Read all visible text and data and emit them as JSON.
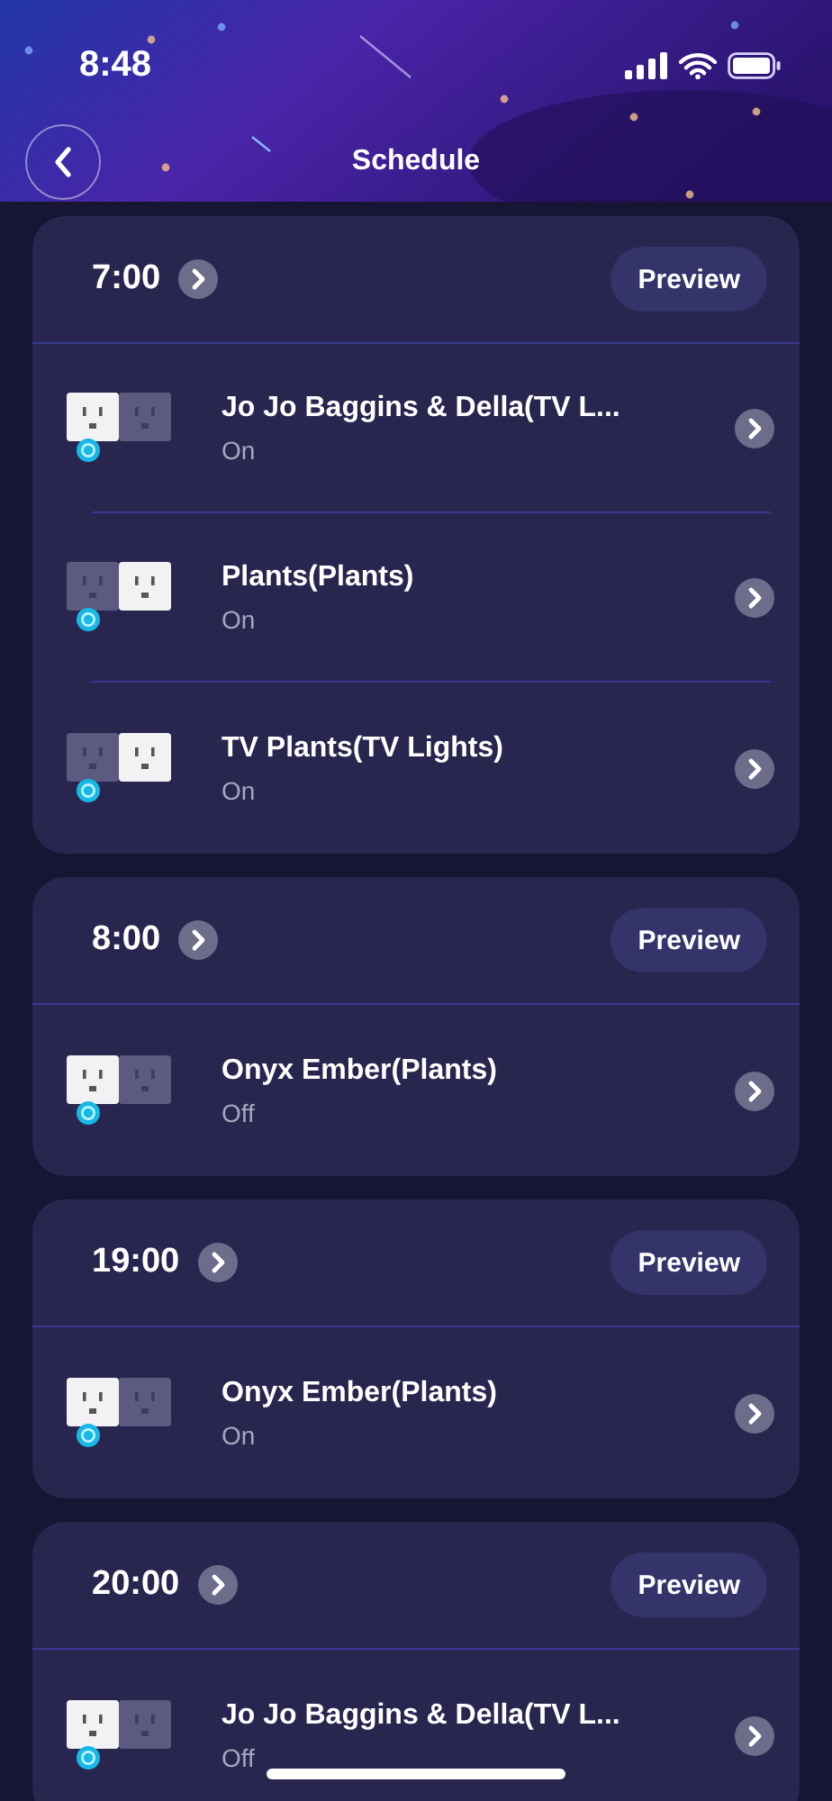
{
  "status_bar": {
    "time": "8:48"
  },
  "nav": {
    "title": "Schedule"
  },
  "schedules": [
    {
      "time": "7:00",
      "action": "Preview",
      "devices": [
        {
          "name": "Jo Jo Baggins & Della(TV L...",
          "state": "On",
          "left_lit": true,
          "right_lit": false
        },
        {
          "name": "Plants(Plants)",
          "state": "On",
          "left_lit": false,
          "right_lit": true
        },
        {
          "name": "TV Plants(TV Lights)",
          "state": "On",
          "left_lit": false,
          "right_lit": true
        }
      ]
    },
    {
      "time": "8:00",
      "action": "Preview",
      "devices": [
        {
          "name": "Onyx Ember(Plants)",
          "state": "Off",
          "left_lit": true,
          "right_lit": false
        }
      ]
    },
    {
      "time": "19:00",
      "action": "Preview",
      "devices": [
        {
          "name": "Onyx Ember(Plants)",
          "state": "On",
          "left_lit": true,
          "right_lit": false
        }
      ]
    },
    {
      "time": "20:00",
      "action": "Preview",
      "devices": [
        {
          "name": "Jo Jo Baggins & Della(TV L...",
          "state": "Off",
          "left_lit": true,
          "right_lit": false
        }
      ]
    }
  ]
}
